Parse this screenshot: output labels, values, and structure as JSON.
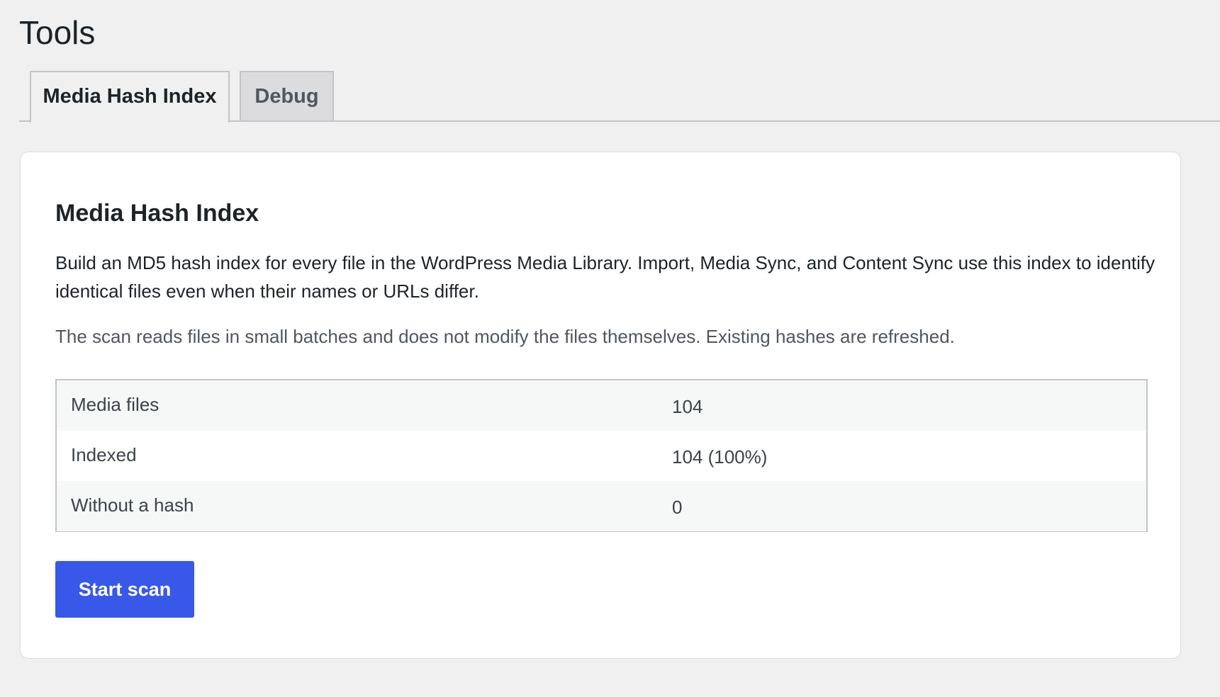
{
  "page": {
    "title": "Tools"
  },
  "tabs": [
    {
      "label": "Media Hash Index",
      "active": true
    },
    {
      "label": "Debug",
      "active": false
    }
  ],
  "card": {
    "title": "Media Hash Index",
    "description": "Build an MD5 hash index for every file in the WordPress Media Library. Import, Media Sync, and Content Sync use this index to identify identical files even when their names or URLs differ.",
    "note": "The scan reads files in small batches and does not modify the files themselves. Existing hashes are refreshed.",
    "stats": [
      {
        "label": "Media files",
        "value": "104"
      },
      {
        "label": "Indexed",
        "value": "104 (100%)"
      },
      {
        "label": "Without a hash",
        "value": "0"
      }
    ],
    "start_button": "Start scan"
  },
  "colors": {
    "accent": "#3858e9",
    "background": "#f0f0f1",
    "card": "#ffffff"
  }
}
